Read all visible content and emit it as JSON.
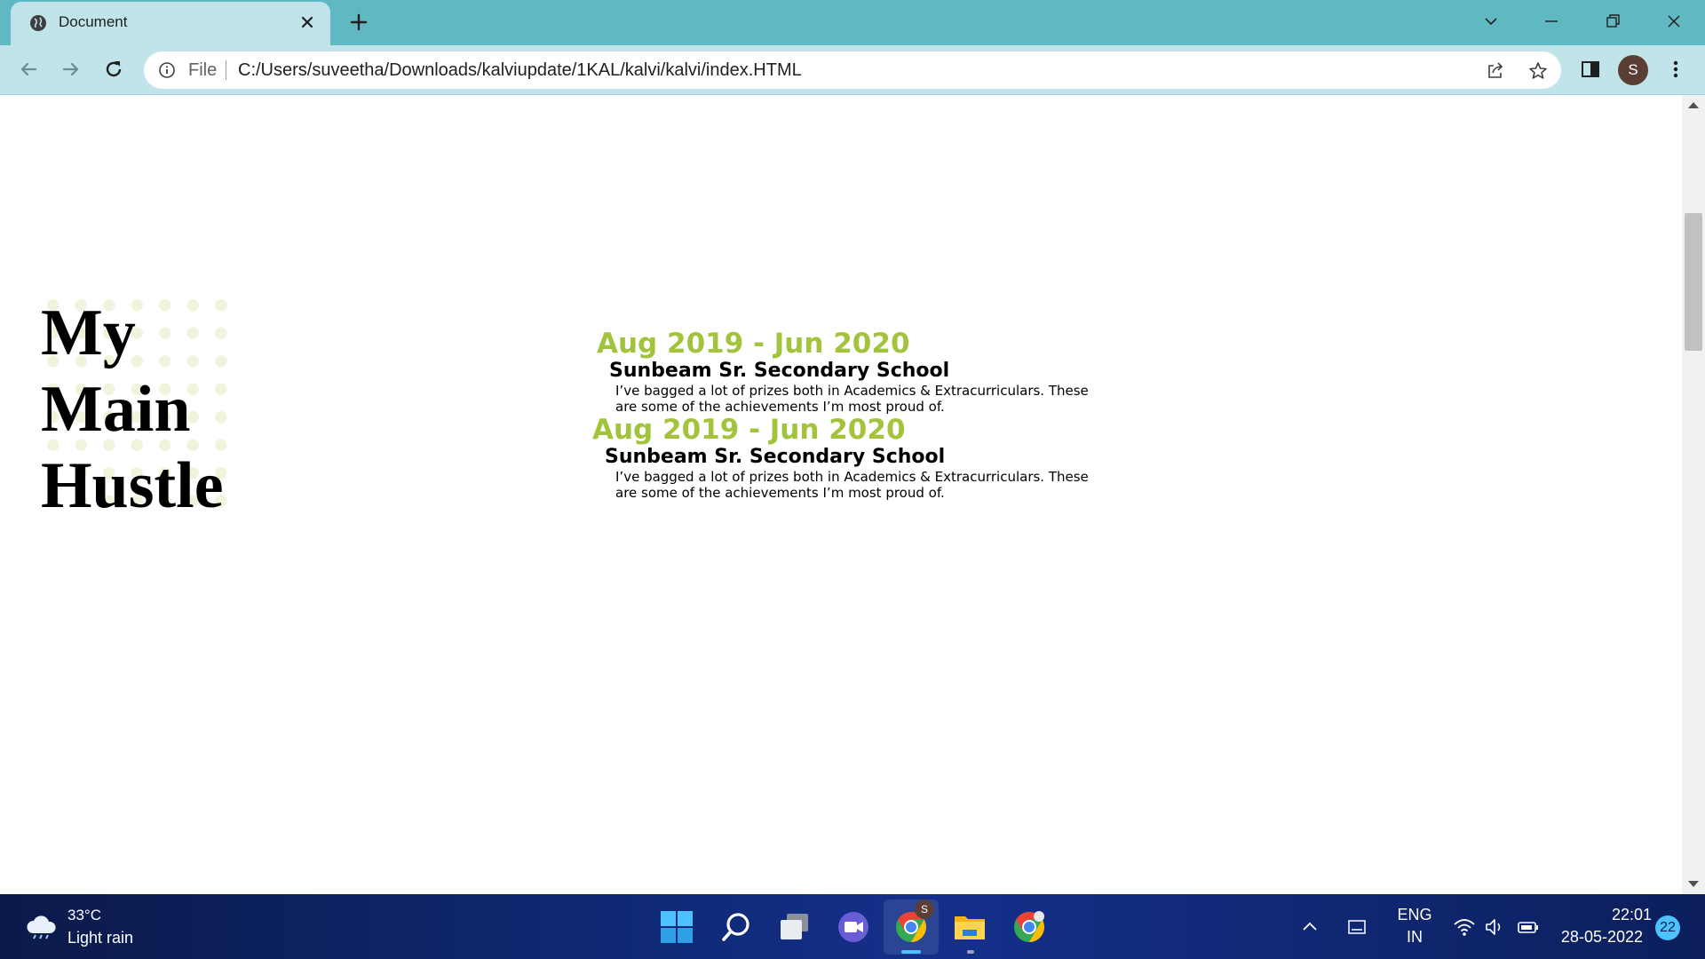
{
  "browser": {
    "tab_title": "Document",
    "address_scheme_label": "File",
    "url": "C:/Users/suveetha/Downloads/kalviupdate/1KAL/kalvi/kalvi/index.HTML",
    "profile_initial": "S"
  },
  "page": {
    "hero_title_lines": [
      "My",
      "Main",
      "Hustle"
    ],
    "entries": [
      {
        "date": "Aug 2019 - Jun 2020",
        "school": "Sunbeam Sr. Secondary School",
        "description": "I’ve bagged a lot of prizes both in Academics & Extracurriculars. These are some of the achievements I’m most proud of."
      },
      {
        "date": "Aug 2019 - Jun 2020",
        "school": "Sunbeam Sr. Secondary School",
        "description": "I’ve bagged a lot of prizes both in Academics & Extracurriculars. These are some of the achievements I’m most proud of."
      }
    ],
    "accent_color": "#a2c43c"
  },
  "taskbar": {
    "weather_temp": "33°C",
    "weather_condition": "Light rain",
    "language": "ENG",
    "region": "IN",
    "time": "22:01",
    "date": "28-05-2022",
    "notification_count": "22",
    "chrome_badge": "S",
    "apps": [
      "start-icon",
      "search-icon",
      "task-view-icon",
      "chat-icon",
      "chrome-icon",
      "file-explorer-icon",
      "chrome-dev-icon"
    ]
  }
}
